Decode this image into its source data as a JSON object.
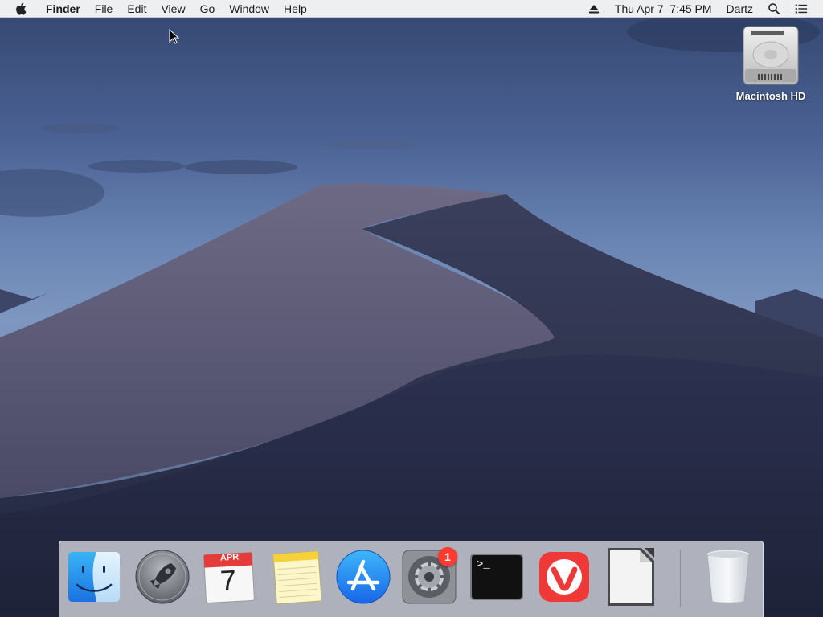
{
  "menubar": {
    "app_name": "Finder",
    "items": [
      "File",
      "Edit",
      "View",
      "Go",
      "Window",
      "Help"
    ],
    "clock": "Thu Apr 7  7:45 PM",
    "user": "Dartz"
  },
  "desktop": {
    "drive_label": "Macintosh HD"
  },
  "dock": {
    "calendar_month": "APR",
    "calendar_day": "7",
    "system_preferences_badge": "1",
    "terminal_prompt": ">_"
  }
}
